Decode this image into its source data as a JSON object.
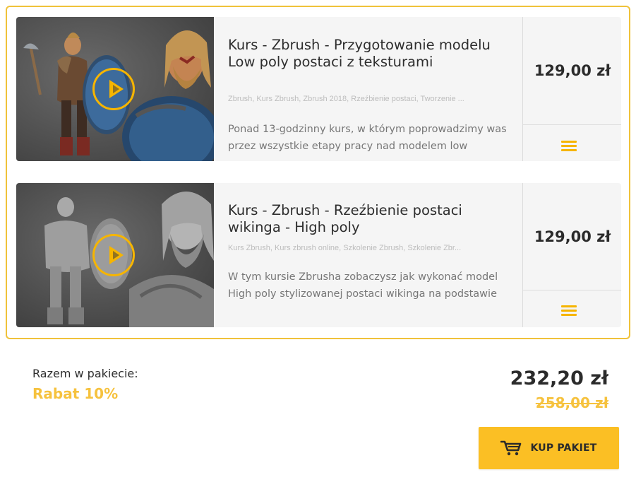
{
  "colors": {
    "accent": "#f6b500",
    "frame": "#f0c23a",
    "card_bg": "#f5f5f5",
    "button_bg": "#fbbf24"
  },
  "courses": [
    {
      "title": "Kurs - Zbrush - Przygotowanie modelu Low poly postaci z teksturami",
      "tags": "Zbrush, Kurs Zbrush, Zbrush 2018, Rzeźbienie postaci, Tworzenie ...",
      "description": "Ponad 13-godzinny kurs, w którym poprowadzimy was przez wszystkie etapy pracy nad modelem low",
      "price": "129,00 zł",
      "play_icon": "play-icon",
      "menu_icon": "hamburger-icon"
    },
    {
      "title": "Kurs - Zbrush - Rzeźbienie postaci wikinga - High poly",
      "tags": "Kurs Zbrush, Kurs zbrush online, Szkolenie Zbrush, Szkolenie Zbr...",
      "description": "W tym kursie Zbrusha zobaczysz jak wykonać model High poly stylizowanej postaci wikinga na podstawie",
      "price": "129,00 zł",
      "play_icon": "play-icon",
      "menu_icon": "hamburger-icon"
    }
  ],
  "summary": {
    "label": "Razem w pakiecie:",
    "discount": "Rabat 10%",
    "total": "232,20 zł",
    "old_price": "258,00 zł"
  },
  "buy_button": {
    "label": "KUP PAKIET",
    "icon": "cart-icon"
  }
}
